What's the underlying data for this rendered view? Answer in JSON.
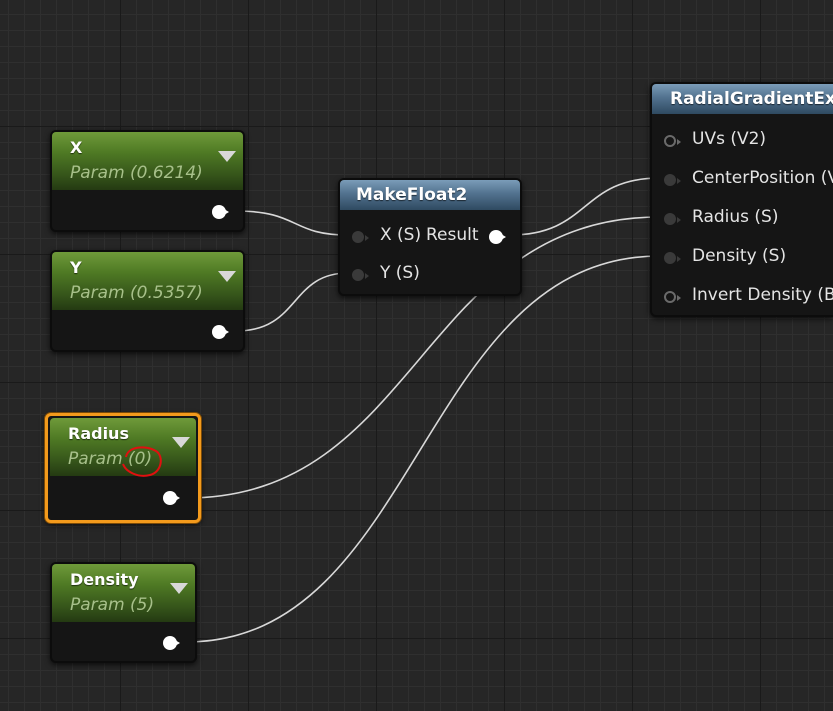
{
  "param_nodes": {
    "x": {
      "title": "X",
      "value": "Param (0.6214)"
    },
    "y": {
      "title": "Y",
      "value": "Param (0.5357)"
    },
    "radius": {
      "title": "Radius",
      "value": "Param (0)",
      "selected": true
    },
    "density": {
      "title": "Density",
      "value": "Param (5)"
    }
  },
  "makefloat2": {
    "title": "MakeFloat2",
    "inputs": [
      "X (S)",
      "Y (S)"
    ],
    "output": "Result"
  },
  "radial": {
    "title": "RadialGradientExp",
    "inputs": [
      "UVs (V2)",
      "CenterPosition (V",
      "Radius (S)",
      "Density (S)",
      "Invert Density (B)"
    ]
  },
  "colors": {
    "background": "#262626",
    "param_header": "#4f7a24",
    "function_header": "#52728f",
    "selection": "#f39a1c",
    "annotation": "#e01010",
    "wire": "#d8d8d8"
  },
  "icons": {
    "dropdown": "triangle-down-icon",
    "output_pin": "filled-circle-arrow-icon",
    "input_pin": "circle-arrow-icon"
  }
}
